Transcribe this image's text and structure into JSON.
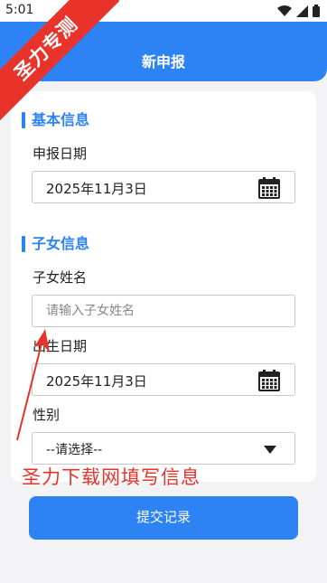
{
  "status_bar": {
    "time": "5:01"
  },
  "header": {
    "title": "新申报"
  },
  "sections": {
    "basic": {
      "title": "基本信息",
      "report_date_label": "申报日期",
      "report_date_value": "2025年11月3日"
    },
    "child": {
      "title": "子女信息",
      "name_label": "子女姓名",
      "name_placeholder": "请输入子女姓名",
      "name_value": "",
      "birth_label": "出生日期",
      "birth_value": "2025年11月3日",
      "gender_label": "性别",
      "gender_value": "--请选择--"
    }
  },
  "submit_label": "提交记录",
  "watermark": {
    "ribbon_text": "圣力专测",
    "annotation_text": "圣力下载网填写信息"
  },
  "colors": {
    "primary": "#2d82f4",
    "watermark_red": "#e8332a",
    "background": "#f3f3f5"
  },
  "icons": [
    "signal-icon",
    "wifi-icon",
    "battery-icon",
    "calendar-icon",
    "dropdown-caret-icon"
  ]
}
